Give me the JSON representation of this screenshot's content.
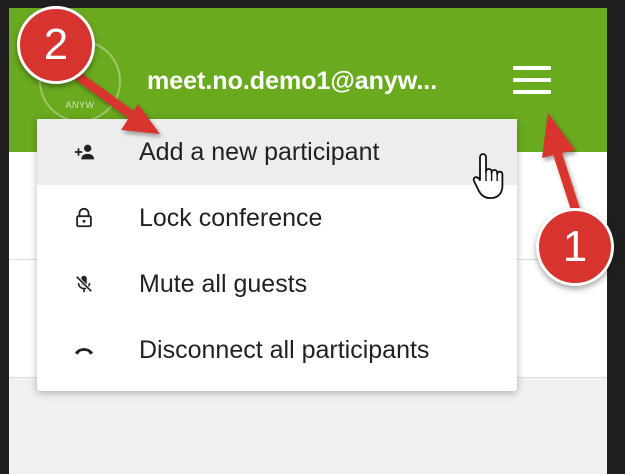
{
  "header": {
    "account_label": "meet.no.demo1@anyw...",
    "logo_text": "ANYW",
    "color": "#6aaa1f"
  },
  "menu": {
    "items": [
      {
        "label": "Add a new participant",
        "icon": "add-person-icon"
      },
      {
        "label": "Lock conference",
        "icon": "lock-icon"
      },
      {
        "label": "Mute all guests",
        "icon": "mic-off-icon"
      },
      {
        "label": "Disconnect all participants",
        "icon": "hang-up-icon"
      }
    ]
  },
  "annotations": {
    "step1": "1",
    "step2": "2",
    "color": "#d8342f"
  }
}
